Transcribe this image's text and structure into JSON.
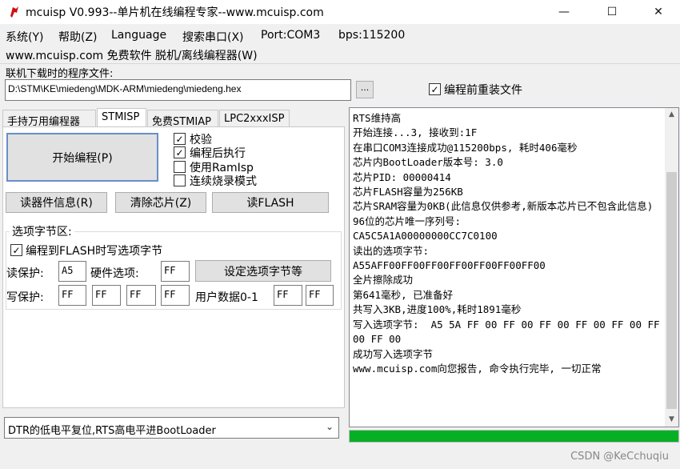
{
  "window": {
    "title": "mcuisp V0.993--单片机在线编程专家--www.mcuisp.com",
    "minimize": "—",
    "maximize": "☐",
    "close": "✕"
  },
  "menu": [
    "系统(Y)",
    "帮助(Z)",
    "Language",
    "搜索串口(X)",
    "Port:COM3",
    "bps:115200"
  ],
  "subtitle": "www.mcuisp.com 免费软件 脱机/离线编程器(W)",
  "file": {
    "label": "联机下载时的程序文件:",
    "path": "D:\\STM\\KE\\miedeng\\MDK-ARM\\miedeng\\miedeng.hex",
    "browse": "...",
    "reload_label": "编程前重装文件",
    "reload_checked": true
  },
  "tabs": [
    "手持万用编程器",
    "STMISP",
    "免费STMIAP",
    "LPC2xxxISP"
  ],
  "active_tab": 1,
  "program_button": "开始编程(P)",
  "options": [
    {
      "label": "校验",
      "checked": true
    },
    {
      "label": "编程后执行",
      "checked": true
    },
    {
      "label": "使用RamIsp",
      "checked": false
    },
    {
      "label": "连续烧录模式",
      "checked": false
    }
  ],
  "buttons": {
    "read_info": "读器件信息(R)",
    "erase": "清除芯片(Z)",
    "read_flash": "读FLASH",
    "set_option": "设定选项字节等"
  },
  "option_bytes": {
    "title": "选项字节区:",
    "write_flash_label": "编程到FLASH时写选项字节",
    "write_flash_checked": true,
    "read_protect_label": "读保护:",
    "read_protect": "A5",
    "hw_option_label": "硬件选项:",
    "hw_option": "FF",
    "write_protect_label": "写保护:",
    "write_protect": [
      "FF",
      "FF",
      "FF",
      "FF"
    ],
    "user_data_label": "用户数据0-1",
    "user_data": [
      "FF",
      "FF"
    ]
  },
  "boot_mode": "DTR的低电平复位,RTS高电平进BootLoader",
  "log": [
    "RTS维持高",
    "开始连接...3, 接收到:1F",
    "在串口COM3连接成功@115200bps, 耗时406毫秒",
    "芯片内BootLoader版本号: 3.0",
    "芯片PID: 00000414",
    "芯片FLASH容量为256KB",
    "芯片SRAM容量为0KB(此信息仅供参考,新版本芯片已不包含此信息)",
    "96位的芯片唯一序列号:",
    "CA5C5A1A00000000CC7C0100",
    "读出的选项字节:",
    "A55AFF00FF00FF00FF00FF00FF00FF00",
    "全片擦除成功",
    "第641毫秒, 已准备好",
    "共写入3KB,进度100%,耗时1891毫秒",
    "写入选项字节:  A5 5A FF 00 FF 00 FF 00 FF 00 FF 00 FF 00 FF 00",
    "成功写入选项字节",
    "www.mcuisp.com向您报告, 命令执行完毕, 一切正常"
  ],
  "progress": 1.0,
  "colors": {
    "progress": "#06b025",
    "accent": "#6a8ec9"
  },
  "watermark": "CSDN @KeCchuqiu"
}
